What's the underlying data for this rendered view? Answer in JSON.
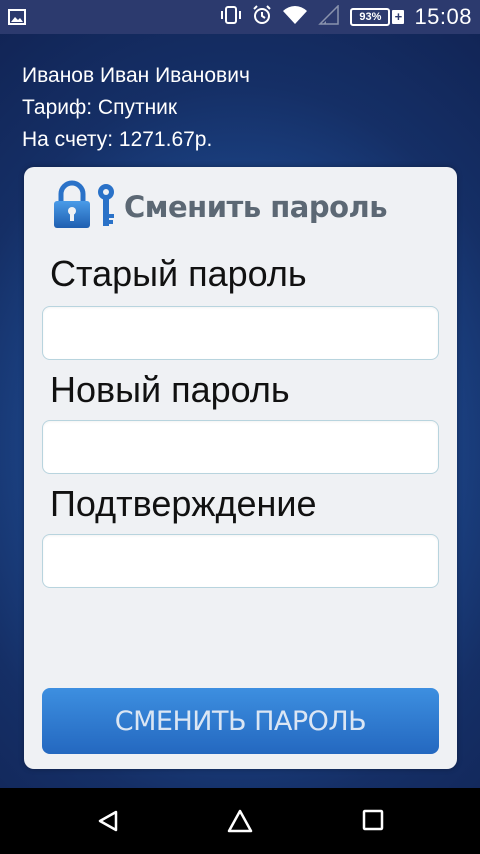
{
  "status_bar": {
    "battery_level": "93%",
    "time": "15:08",
    "icons": [
      "image-icon",
      "vibrate-icon",
      "alarm-icon",
      "wifi-icon",
      "signal-icon",
      "battery-icon"
    ]
  },
  "user": {
    "name": "Иванов Иван Иванович",
    "tariff": "Тариф: Спутник",
    "balance": "На счету: 1271.67р."
  },
  "form": {
    "title": "Сменить пароль",
    "old_password_label": "Старый пароль",
    "new_password_label": "Новый пароль",
    "confirm_label": "Подтверждение",
    "old_password_value": "",
    "new_password_value": "",
    "confirm_value": "",
    "submit_label": "СМЕНИТЬ ПАРОЛЬ"
  },
  "nav": {
    "icons": [
      "back-icon",
      "home-icon",
      "recents-icon"
    ]
  },
  "colors": {
    "accent": "#2d7bd6",
    "status_bar": "#2c3a6e",
    "title": "#5c6874",
    "card": "#eff1f4"
  }
}
